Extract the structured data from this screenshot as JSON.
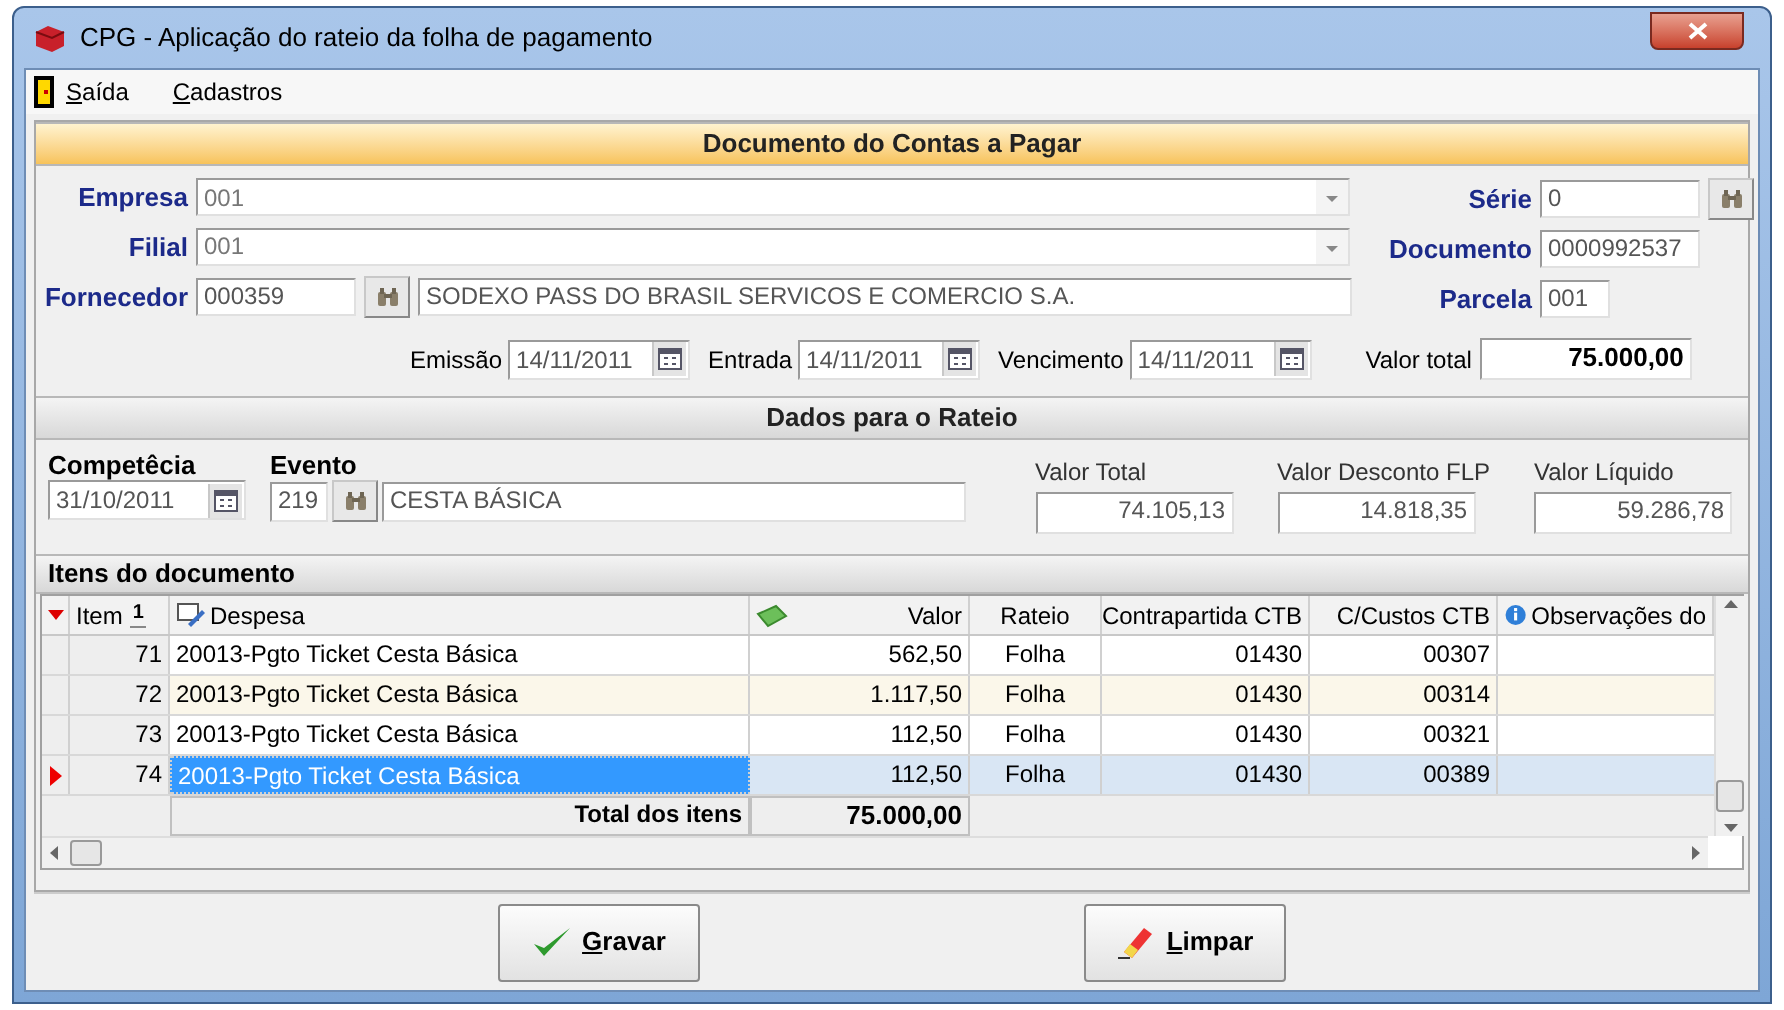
{
  "window": {
    "title": "CPG - Aplicação do rateio da folha de pagamento"
  },
  "menu": [
    {
      "label": "Saída"
    },
    {
      "label": "Cadastros"
    }
  ],
  "document": {
    "title": "Documento do Contas a Pagar",
    "empresa": {
      "label": "Empresa",
      "value": "001"
    },
    "filial": {
      "label": "Filial",
      "value": "001"
    },
    "fornecedor": {
      "label": "Fornecedor",
      "code": "000359",
      "name": "SODEXO PASS DO BRASIL SERVICOS E COMERCIO S.A."
    },
    "serie": {
      "label": "Série",
      "value": "0"
    },
    "documento": {
      "label": "Documento",
      "value": "0000992537"
    },
    "parcela": {
      "label": "Parcela",
      "value": "001"
    },
    "dates": [
      {
        "label": "Emissão",
        "value": "14/11/2011"
      },
      {
        "label": "Entrada",
        "value": "14/11/2011"
      },
      {
        "label": "Vencimento",
        "value": "14/11/2011"
      }
    ],
    "valor_total": {
      "label": "Valor total",
      "value": "75.000,00"
    }
  },
  "rateio": {
    "title": "Dados para o Rateio",
    "competencia": {
      "label": "Competêcia",
      "value": "31/10/2011"
    },
    "evento": {
      "label": "Evento",
      "code": "219",
      "name": "CESTA BÁSICA"
    },
    "values": [
      {
        "label": "Valor Total",
        "value": "74.105,13"
      },
      {
        "label": "Valor Desconto FLP",
        "value": "14.818,35"
      },
      {
        "label": "Valor Líquido",
        "value": "59.286,78"
      }
    ]
  },
  "items": {
    "title": "Itens do documento",
    "columns": [
      {
        "label": "Item",
        "sort_rank": "1"
      },
      {
        "label": "Despesa"
      },
      {
        "label": "Valor"
      },
      {
        "label": "Rateio"
      },
      {
        "label": "Contrapartida CTB"
      },
      {
        "label": "C/Custos CTB"
      },
      {
        "label": "Observações do"
      }
    ],
    "rows": [
      {
        "item": "71",
        "despesa": "20013-Pgto Ticket Cesta Básica",
        "valor": "562,50",
        "rateio": "Folha",
        "contrapartida": "01430",
        "custos": "00307",
        "selected": false
      },
      {
        "item": "72",
        "despesa": "20013-Pgto Ticket Cesta Básica",
        "valor": "1.117,50",
        "rateio": "Folha",
        "contrapartida": "01430",
        "custos": "00314",
        "selected": false
      },
      {
        "item": "73",
        "despesa": "20013-Pgto Ticket Cesta Básica",
        "valor": "112,50",
        "rateio": "Folha",
        "contrapartida": "01430",
        "custos": "00321",
        "selected": false
      },
      {
        "item": "74",
        "despesa": "20013-Pgto Ticket Cesta Básica",
        "valor": "112,50",
        "rateio": "Folha",
        "contrapartida": "01430",
        "custos": "00389",
        "selected": true
      }
    ],
    "total_label": "Total dos itens",
    "total_value": "75.000,00"
  },
  "buttons": [
    {
      "kind": "save",
      "label": "Gravar"
    },
    {
      "kind": "clear",
      "label": "Limpar"
    }
  ]
}
